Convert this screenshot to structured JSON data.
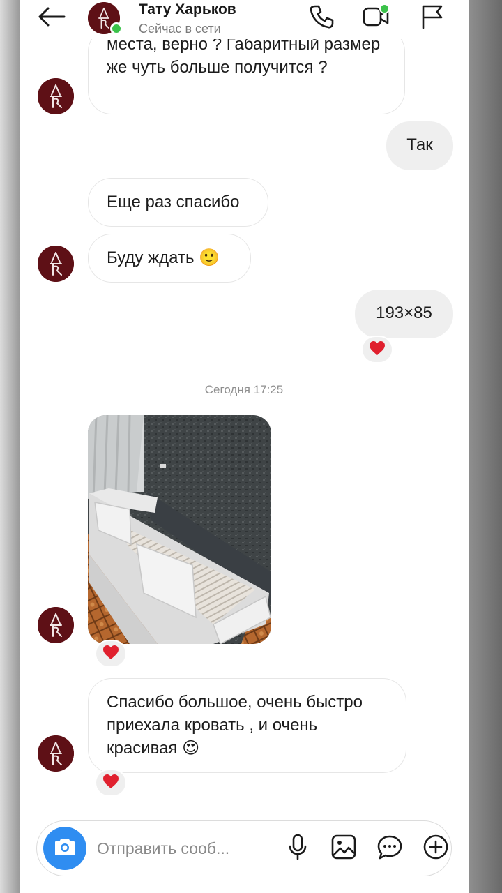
{
  "header": {
    "contact_name": "Тату Харьков",
    "status": "Сейчас в сети",
    "icons": [
      "back-arrow-icon",
      "phone-icon",
      "video-camera-icon",
      "flag-icon"
    ]
  },
  "messages": [
    {
      "type": "incoming",
      "text": "места, верно ? Габаритный размер же чуть больше получится ?"
    },
    {
      "type": "outgoing",
      "text": "Так"
    },
    {
      "type": "incoming",
      "text": "Еще раз спасибо"
    },
    {
      "type": "incoming",
      "text": "Буду ждать 🙂"
    },
    {
      "type": "outgoing",
      "text": "193×85",
      "reaction": "❤️"
    },
    {
      "type": "incoming",
      "attachment": "photo",
      "reaction": "❤️"
    },
    {
      "type": "incoming",
      "text": "Спасибо большое, очень быстро приехала кровать , и очень красивая 😍",
      "reaction": "❤️"
    }
  ],
  "timestamp": "Сегодня 17:25",
  "composer": {
    "placeholder": "Отправить сооб...",
    "icons": [
      "camera-icon",
      "microphone-icon",
      "gallery-icon",
      "sticker-icon",
      "plus-icon"
    ]
  },
  "colors": {
    "accent_blue": "#2f8df1",
    "online_green": "#3bc24a",
    "avatar_maroon": "#5e1016",
    "reaction_red": "#e0202e",
    "outgoing_bubble": "#efefef"
  }
}
